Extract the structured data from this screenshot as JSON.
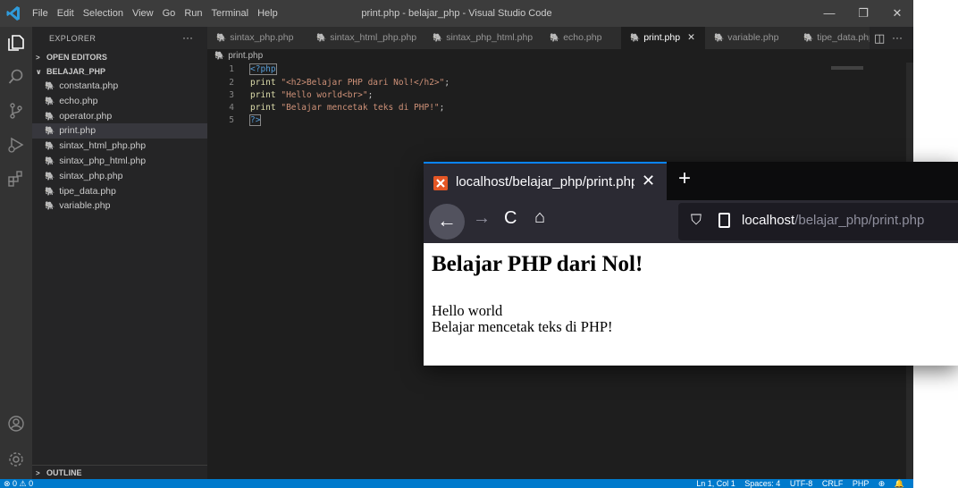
{
  "titlebar": {
    "menu": [
      "File",
      "Edit",
      "Selection",
      "View",
      "Go",
      "Run",
      "Terminal",
      "Help"
    ],
    "title": "print.php - belajar_php - Visual Studio Code",
    "minimize": "—",
    "restore": "❐",
    "close": "✕"
  },
  "sidebar": {
    "title": "EXPLORER",
    "more": "···",
    "open_editors": "OPEN EDITORS",
    "project": "BELAJAR_PHP",
    "files": [
      "constanta.php",
      "echo.php",
      "operator.php",
      "print.php",
      "sintax_html_php.php",
      "sintax_php_html.php",
      "sintax_php.php",
      "tipe_data.php",
      "variable.php"
    ],
    "selected_file": "print.php",
    "outline": "OUTLINE",
    "file_icon": "php-file-icon"
  },
  "tabs": {
    "items": [
      "sintax_php.php",
      "sintax_html_php.php",
      "sintax_php_html.php",
      "echo.php",
      "print.php",
      "variable.php",
      "tipe_data.php"
    ],
    "active": "print.php",
    "close_glyph": "✕",
    "split_glyph": "◫",
    "more_glyph": "···"
  },
  "breadcrumb": {
    "file": "print.php"
  },
  "editor": {
    "line_numbers": [
      "1",
      "2",
      "3",
      "4",
      "5"
    ],
    "lines": [
      {
        "tag": "<?php"
      },
      {
        "kw": "print",
        "str": "\"<h2>Belajar PHP dari Nol!</h2>\"",
        "end": ";"
      },
      {
        "kw": "print",
        "str": "\"Hello world<br>\"",
        "end": ";"
      },
      {
        "kw": "print",
        "str": "\"Belajar mencetak teks di PHP!\"",
        "end": ";"
      },
      {
        "tag": "?>"
      }
    ]
  },
  "statusbar": {
    "problems": "⊗ 0 ⚠ 0",
    "position": "Ln 1, Col 1",
    "spaces": "Spaces: 4",
    "encoding": "UTF-8",
    "eol": "CRLF",
    "language": "PHP",
    "feedback": "⊕",
    "bell": "🔔"
  },
  "browser": {
    "tab_title": "localhost/belajar_php/print.php",
    "tab_close": "✕",
    "new_tab": "+",
    "back": "←",
    "forward": "→",
    "reload": "C",
    "home": "⌂",
    "url_host": "localhost",
    "url_path": "/belajar_php/print.php",
    "shield": "⛉",
    "favicon": "XAMPP",
    "page": {
      "heading": "Belajar PHP dari Nol!",
      "line1": "Hello world",
      "line2": "Belajar mencetak teks di PHP!"
    }
  },
  "colors": {
    "editor_bg": "#1e1e1e",
    "sidebar_bg": "#252526",
    "activity_bg": "#333333",
    "titlebar_bg": "#3c3c3c",
    "statusbar_bg": "#007acc",
    "keyword": "#569cd6",
    "string": "#ce9178",
    "function": "#dcdcaa",
    "php_icon": "#a074c4"
  }
}
